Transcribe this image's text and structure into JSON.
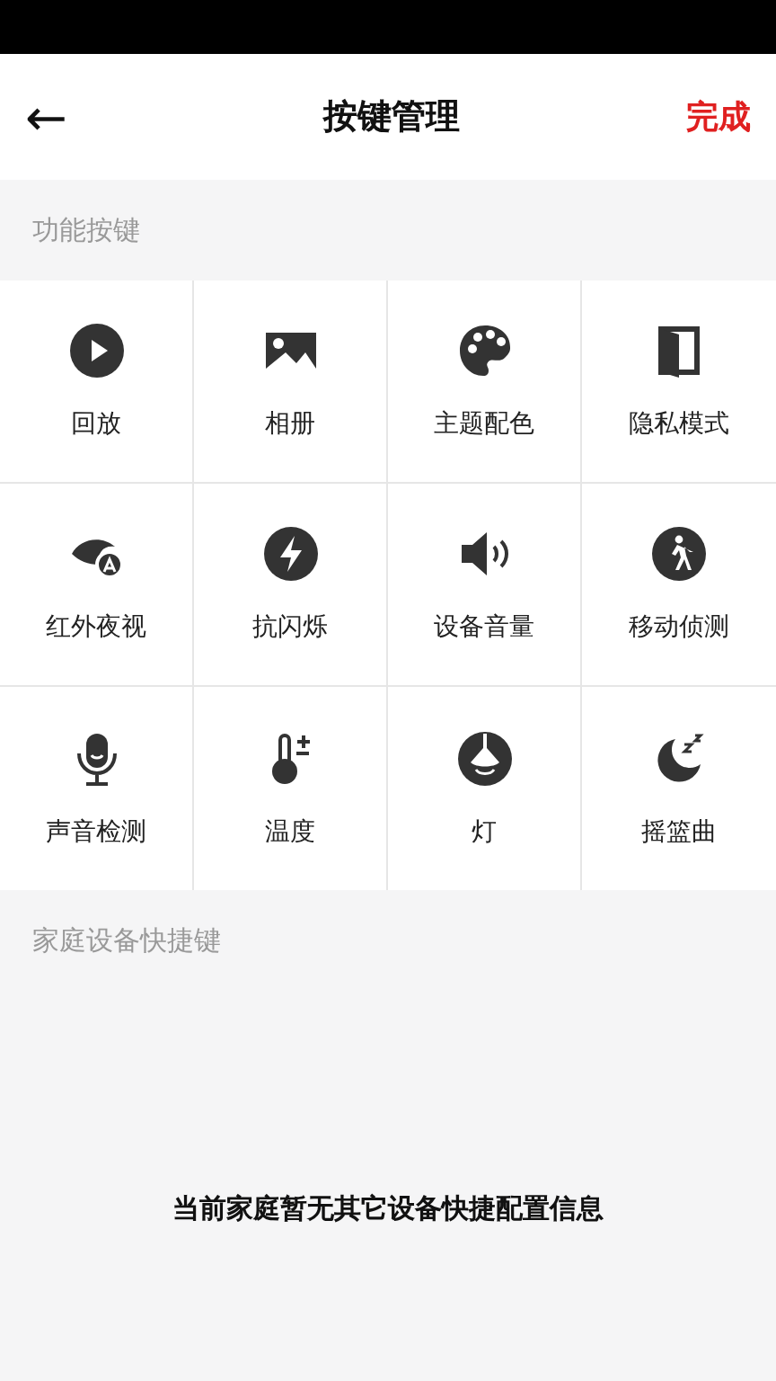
{
  "header": {
    "back": "←",
    "title": "按键管理",
    "done": "完成"
  },
  "function_section": {
    "title": "功能按键",
    "keys": [
      {
        "label": "回放"
      },
      {
        "label": "相册"
      },
      {
        "label": "主题配色"
      },
      {
        "label": "隐私模式"
      },
      {
        "label": "红外夜视"
      },
      {
        "label": "抗闪烁"
      },
      {
        "label": "设备音量"
      },
      {
        "label": "移动侦测"
      },
      {
        "label": "声音检测"
      },
      {
        "label": "温度"
      },
      {
        "label": "灯"
      },
      {
        "label": "摇篮曲"
      }
    ]
  },
  "home_section": {
    "title": "家庭设备快捷键",
    "empty_message": "当前家庭暂无其它设备快捷配置信息"
  }
}
